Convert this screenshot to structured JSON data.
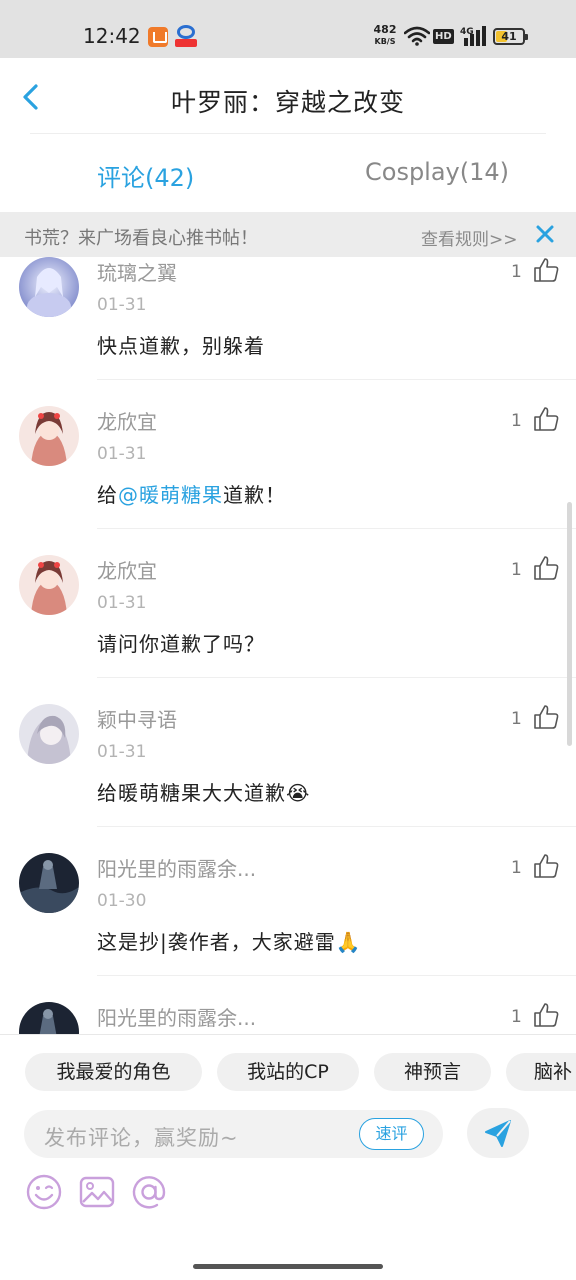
{
  "status_bar": {
    "time": "12:42",
    "net_speed_value": "482",
    "net_speed_unit": "KB/S",
    "hd_label": "HD",
    "network_type": "4G",
    "battery_level": "41",
    "battery_fraction": 0.41,
    "app_icons": [
      "orange-app-icon",
      "blue-red-app-icon"
    ]
  },
  "header": {
    "title": "叶罗丽：穿越之改变",
    "back_icon": "chevron-left-icon"
  },
  "tabs": [
    {
      "label": "评论(42)",
      "active": true
    },
    {
      "label": "Cosplay(14)",
      "active": false
    }
  ],
  "notice": {
    "text": "书荒？来广场看良心推书帖！",
    "link": "查看规则>>",
    "close_icon": "close-icon"
  },
  "comments": [
    {
      "user": "琉璃之翼",
      "date": "01-31",
      "text": "快点道歉，别躲着",
      "likes": "1"
    },
    {
      "user": "龙欣宜",
      "date": "01-31",
      "text_before": "给",
      "mention": "@暖萌糖果",
      "text_after": "道歉！",
      "likes": "1"
    },
    {
      "user": "龙欣宜",
      "date": "01-31",
      "text": "请问你道歉了吗？",
      "likes": "1"
    },
    {
      "user": "颖中寻语",
      "date": "01-31",
      "text": "给暖萌糖果大大道歉",
      "emoji": "😭",
      "likes": "1"
    },
    {
      "user": "阳光里的雨露余...",
      "date": "01-30",
      "text": "这是抄|袭作者，大家避雷",
      "emoji": "🙏",
      "likes": "1"
    },
    {
      "user": "阳光里的雨露余...",
      "likes": "1"
    }
  ],
  "chips": [
    "我最爱的角色",
    "我站的CP",
    "神预言",
    "脑补"
  ],
  "input": {
    "placeholder": "发布评论，赢奖励~",
    "quick_label": "速评"
  },
  "toolbar_icons": [
    "emoji-icon",
    "image-icon",
    "at-icon"
  ],
  "colors": {
    "accent": "#2aa2e0",
    "toolbar_icon": "#c9a0dc",
    "status_bar_bg": "#e2e2e2",
    "battery_fill": "#f2c230"
  }
}
